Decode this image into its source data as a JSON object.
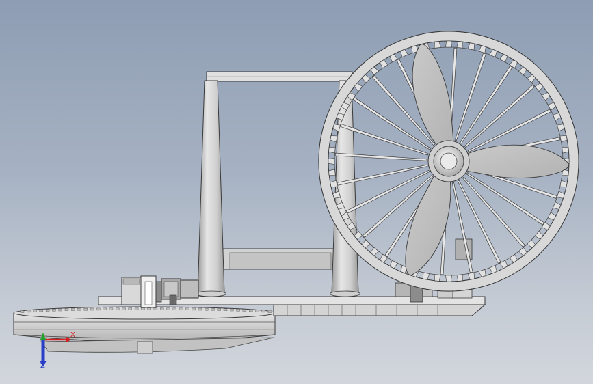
{
  "view": {
    "background_top": "#8e9db3",
    "background_bottom": "#d2d6dc",
    "part_fill": "#d8d8d8",
    "part_edge": "#3a3a3a"
  },
  "triad": {
    "x_label": "X",
    "z_label": "Z",
    "x_color": "#d42020",
    "y_color": "#22a02a",
    "z_color": "#2a3fc8"
  },
  "wheel": {
    "spokes": 24,
    "teeth": 64,
    "blades": 3
  },
  "turntable": {
    "teeth": 40
  }
}
